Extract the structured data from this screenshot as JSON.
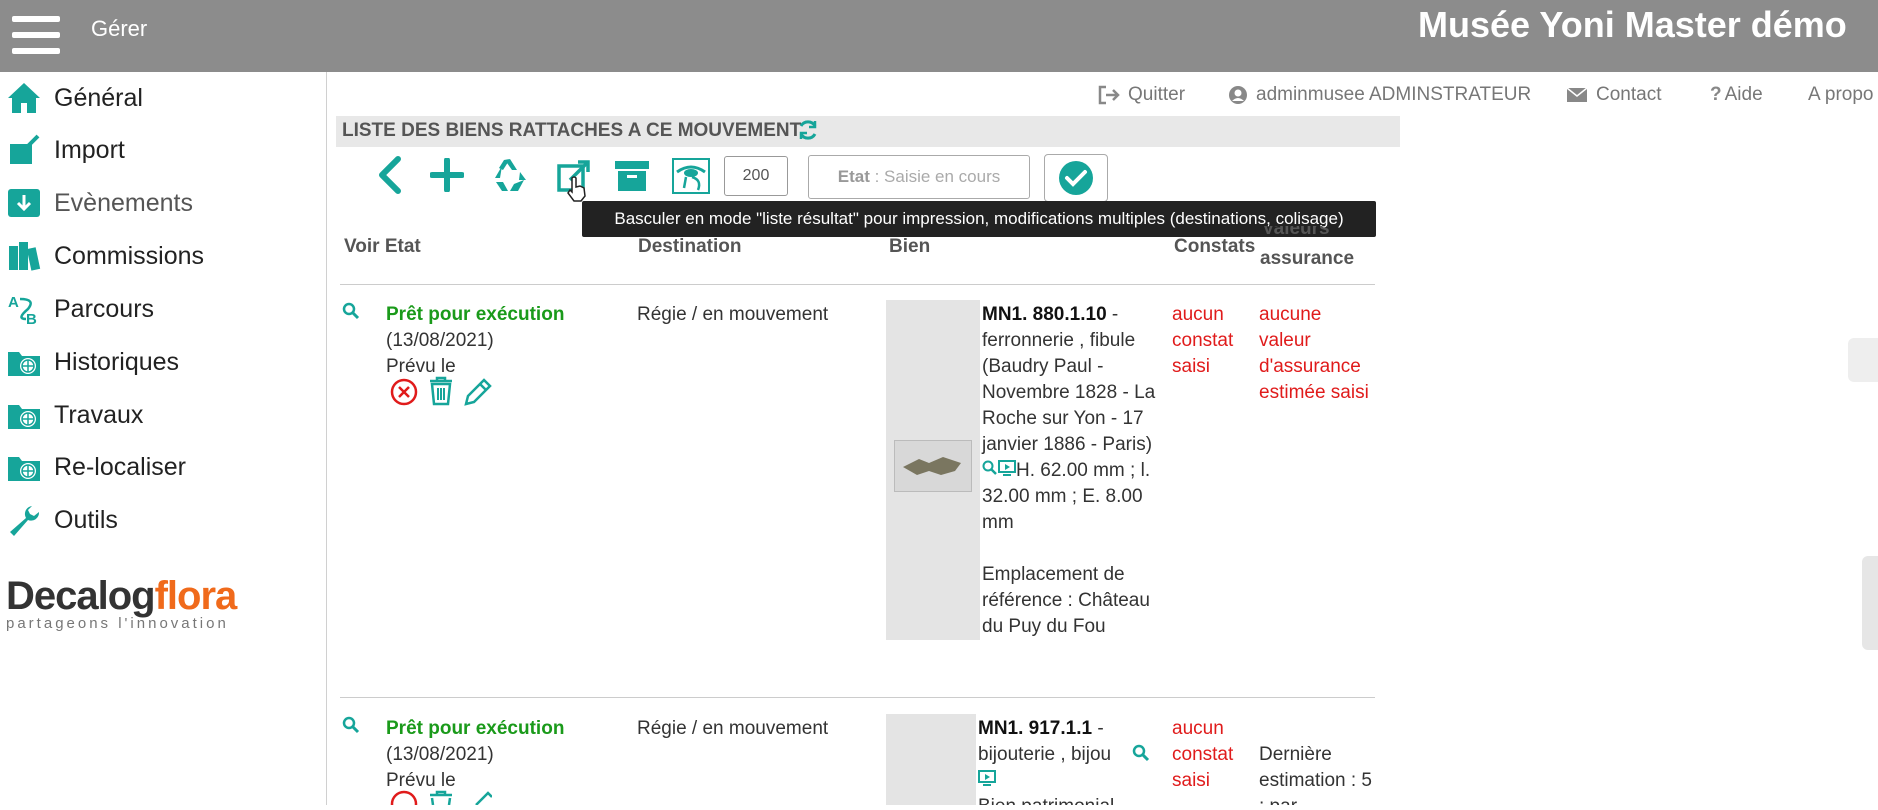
{
  "header": {
    "menu_label": "Gérer",
    "site_title": "Musée Yoni Master démo"
  },
  "sidebar": {
    "items": [
      {
        "label": "Général",
        "icon": "home-icon"
      },
      {
        "label": "Import",
        "icon": "import-icon"
      },
      {
        "label": "Evènements",
        "icon": "download-box-icon"
      },
      {
        "label": "Commissions",
        "icon": "books-icon"
      },
      {
        "label": "Parcours",
        "icon": "route-icon"
      },
      {
        "label": "Historiques",
        "icon": "globe-folder-icon"
      },
      {
        "label": "Travaux",
        "icon": "globe-folder-icon"
      },
      {
        "label": "Re-localiser",
        "icon": "globe-folder-icon"
      },
      {
        "label": "Outils",
        "icon": "wrench-icon"
      }
    ],
    "logo": {
      "word1": "Decalog",
      "word2": "flora",
      "tagline": "partageons l'innovation"
    }
  },
  "utility_nav": {
    "quit": "Quitter",
    "user": "adminmusee ADMINSTRATEUR",
    "contact": "Contact",
    "help": "Aide",
    "about": "A propo"
  },
  "section": {
    "title": "LISTE DES BIENS RATTACHES A CE MOUVEMENT"
  },
  "toolbar": {
    "count": "200",
    "etat_label": "Etat",
    "etat_value": " : Saisie en cours",
    "tooltip": "Basculer en mode \"liste résultat\" pour impression, modifications multiples (destinations, colisage)"
  },
  "table": {
    "headers": {
      "voir_etat": "Voir Etat",
      "destination": "Destination",
      "bien": "Bien",
      "constats": "Constats",
      "valeurs_1": "Valeurs",
      "valeurs_2": "assurance"
    },
    "rows": [
      {
        "etat": "Prêt pour exécution",
        "date": "(13/08/2021)",
        "prevu": "Prévu le",
        "destination": "Régie / en mouvement",
        "bien_id": "MN1. 880.1.10",
        "bien_sep": " -",
        "bien_desc": "ferronnerie , fibule (Baudry Paul - Novembre 1828 - La Roche sur Yon - 17 janvier 1886 - Paris)",
        "dims_1": "H. 62.00 mm ; l.",
        "dims_2": "32.00 mm ; E. 8.00 mm",
        "emplacement": "Emplacement de référence : Château du Puy du Fou",
        "constat": "aucun constat saisi",
        "valeur": "aucune valeur d'assurance estimée saisi"
      },
      {
        "etat": "Prêt pour exécution",
        "date": "(13/08/2021)",
        "prevu": "Prévu le",
        "destination": "Régie / en mouvement",
        "bien_id": "MN1. 917.1.1",
        "bien_sep": " -",
        "bien_desc": "bijouterie , bijou",
        "bien_extra": "Bien patrimonial",
        "constat": "aucun constat saisi",
        "valeur": "Dernière estimation : 5 : par"
      }
    ]
  },
  "colors": {
    "teal": "#16a59a",
    "green": "#1a9a1a",
    "red": "#e01b1b",
    "brand_orange": "#f06a1b",
    "topbar": "#8c8c8c"
  }
}
